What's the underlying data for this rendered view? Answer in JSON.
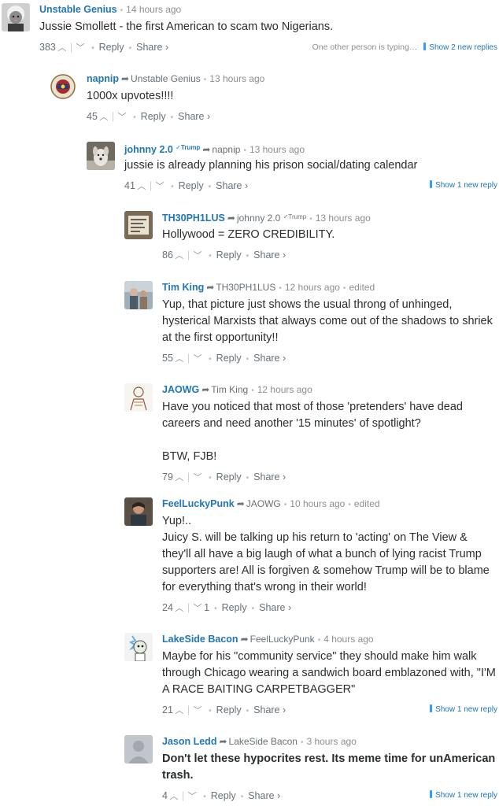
{
  "comments": [
    {
      "author": "Unstable Genius",
      "parent": "",
      "time": "14 hours ago",
      "edited": "",
      "text": [
        "Jussie Smollett - the first American to scam two Nigerians."
      ],
      "votes_up": "383",
      "votes_down": "",
      "typing": "One other person is typing…",
      "new_replies": "Show 2 new replies",
      "avatar_icon": "einstein-avatar-icon"
    },
    {
      "author": "napnip",
      "parent": "Unstable Genius",
      "time": "13 hours ago",
      "edited": "",
      "text": [
        "1000x upvotes!!!!"
      ],
      "votes_up": "45",
      "votes_down": "",
      "new_replies": "",
      "avatar_icon": "emblem-avatar-icon"
    },
    {
      "author": "johnny 2.0",
      "author_badge": "Trump",
      "parent": "napnip",
      "time": "13 hours ago",
      "edited": "",
      "text": [
        "jussie is already planning his prison social/dating calendar"
      ],
      "votes_up": "41",
      "votes_down": "",
      "new_replies": "Show 1 new reply",
      "avatar_icon": "dog-avatar-icon"
    },
    {
      "author": "TH30PH1LUS",
      "parent": "johnny 2.0",
      "parent_badge": "Trump",
      "time": "13 hours ago",
      "edited": "",
      "text": [
        "Hollywood = ZERO CREDIBILITY."
      ],
      "votes_up": "86",
      "votes_down": "",
      "new_replies": "",
      "avatar_icon": "sign-avatar-icon"
    },
    {
      "author": "Tim King",
      "parent": "TH30PH1LUS",
      "time": "12 hours ago",
      "edited": "edited",
      "text": [
        "Yup, that picture just shows the usual throng of unhinged, hysterical Marxists that always come out of the shadows to shriek at the first opportunity!!"
      ],
      "votes_up": "55",
      "votes_down": "",
      "new_replies": "",
      "avatar_icon": "photo-avatar-icon"
    },
    {
      "author": "JAOWG",
      "parent": "Tim King",
      "time": "12 hours ago",
      "edited": "",
      "text": [
        "Have you noticed that most of those 'pretenders' have dead careers and need another '15 minutes' of spotlight?",
        "BTW, FJB!"
      ],
      "votes_up": "79",
      "votes_down": "",
      "new_replies": "",
      "avatar_icon": "sketch-avatar-icon"
    },
    {
      "author": "FeelLuckyPunk",
      "parent": "JAOWG",
      "time": "10 hours ago",
      "edited": "edited",
      "text": [
        "Yup!..\nJuicy S. will be talking up his return to 'acting' on The View & they'll all have a big laugh of what a bunch of lying racist Trump supporters are! All is forgiven & somehow Trump will be to blame for everything that's wrong in their world!"
      ],
      "votes_up": "24",
      "votes_down": "1",
      "new_replies": "",
      "avatar_icon": "portrait-avatar-icon"
    },
    {
      "author": "LakeSide Bacon",
      "parent": "FeelLuckyPunk",
      "time": "4 hours ago",
      "edited": "",
      "text": [
        "Maybe for his \"community service\" they should make him walk through Chicago wearing a sandwich board emblazoned with, \"I'M A RACE BAITING CARPETBAGGER\""
      ],
      "votes_up": "21",
      "votes_down": "",
      "new_replies": "Show 1 new reply",
      "avatar_icon": "cartoon-avatar-icon"
    },
    {
      "author": "Jason Ledd",
      "parent": "LakeSide Bacon",
      "time": "3 hours ago",
      "edited": "",
      "bold": true,
      "text": [
        "Don't let these hypocrites rest. Its meme time for unAmerican trash."
      ],
      "votes_up": "4",
      "votes_down": "",
      "new_replies": "Show 1 new reply",
      "avatar_icon": "default-user-avatar-icon"
    }
  ],
  "labels": {
    "reply": "Reply",
    "share": "Share",
    "share_arrow": "›"
  },
  "colors": {
    "author": "#2176b6",
    "new_reply_bar": "#2e9fff",
    "meta": "#687076"
  }
}
